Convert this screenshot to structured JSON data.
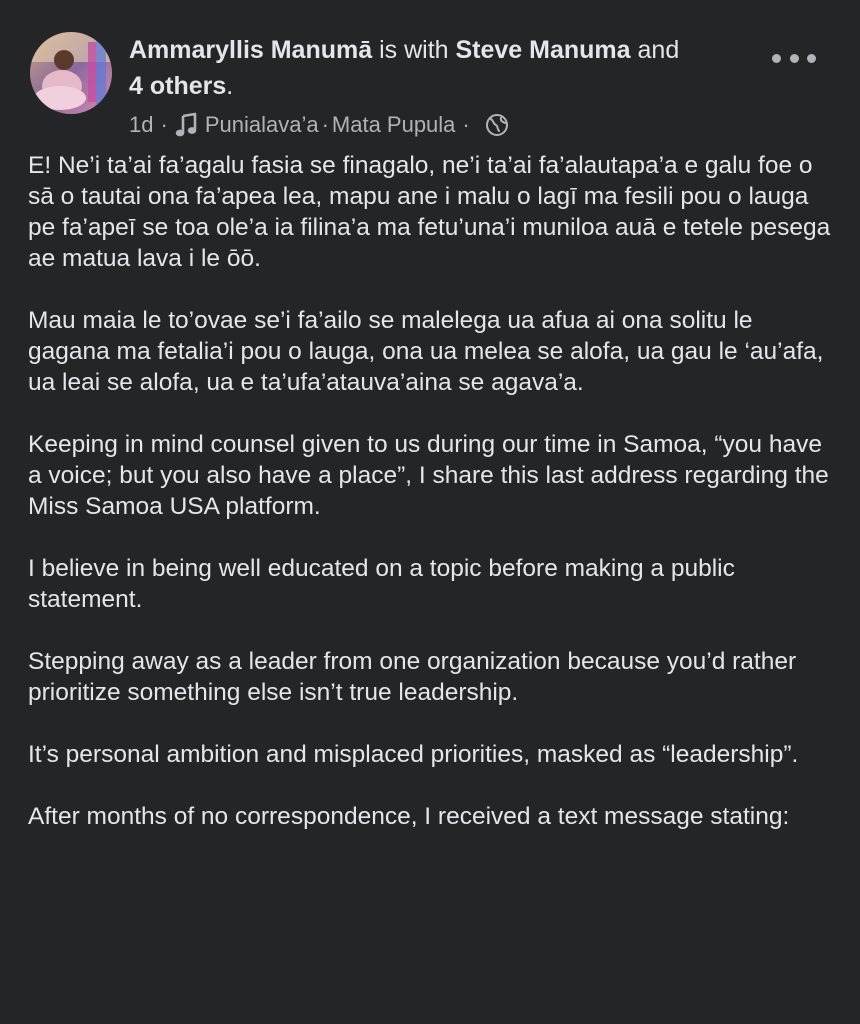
{
  "post": {
    "author": "Ammaryllis Manumā",
    "with_text": " is with ",
    "tagged": "Steve Manuma",
    "and_text": " and",
    "others": "4 others",
    "period": ".",
    "time": "1d",
    "audio": "Punialava’a",
    "privacy_label": "Mata Pupula",
    "more_icon": "more-horizontal-icon",
    "music_icon": "music-note-icon",
    "privacy_icon": "globe-icon",
    "paragraphs": [
      "E! Ne’i ta’ai fa’agalu fasia se finagalo, ne’i ta’ai fa’alautapa’a e galu foe o sā o tautai ona fa’apea lea, mapu ane i malu o lagī ma fesili pou o lauga pe fa’apeī se toa ole’a ia filina’a ma fetu’una’i muniloa auā e tetele pesega ae matua lava i le ōō.",
      "Mau maia le to’ovae se’i fa’ailo se malelega ua afua ai ona solitu le gagana ma fetalia’i pou o lauga, ona ua melea se alofa, ua gau le ‘au’afa, ua leai se alofa, ua e ta’ufa’atauva’aina se agava’a.",
      "Keeping in mind counsel given to us during our time in Samoa, “you have a voice; but you also have a place”, I share this last address regarding the Miss Samoa USA platform.",
      "I believe in being well educated on a topic before making a public statement.",
      "Stepping away as a leader from one organization because you’d rather prioritize something else isn’t true leadership.",
      "It’s personal ambition and misplaced priorities, masked as “leadership”.",
      "After months of no correspondence, I received a text message stating:"
    ]
  },
  "colors": {
    "background": "#242526",
    "primary_text": "#e4e6eb",
    "secondary_text": "#b0b3b8"
  }
}
